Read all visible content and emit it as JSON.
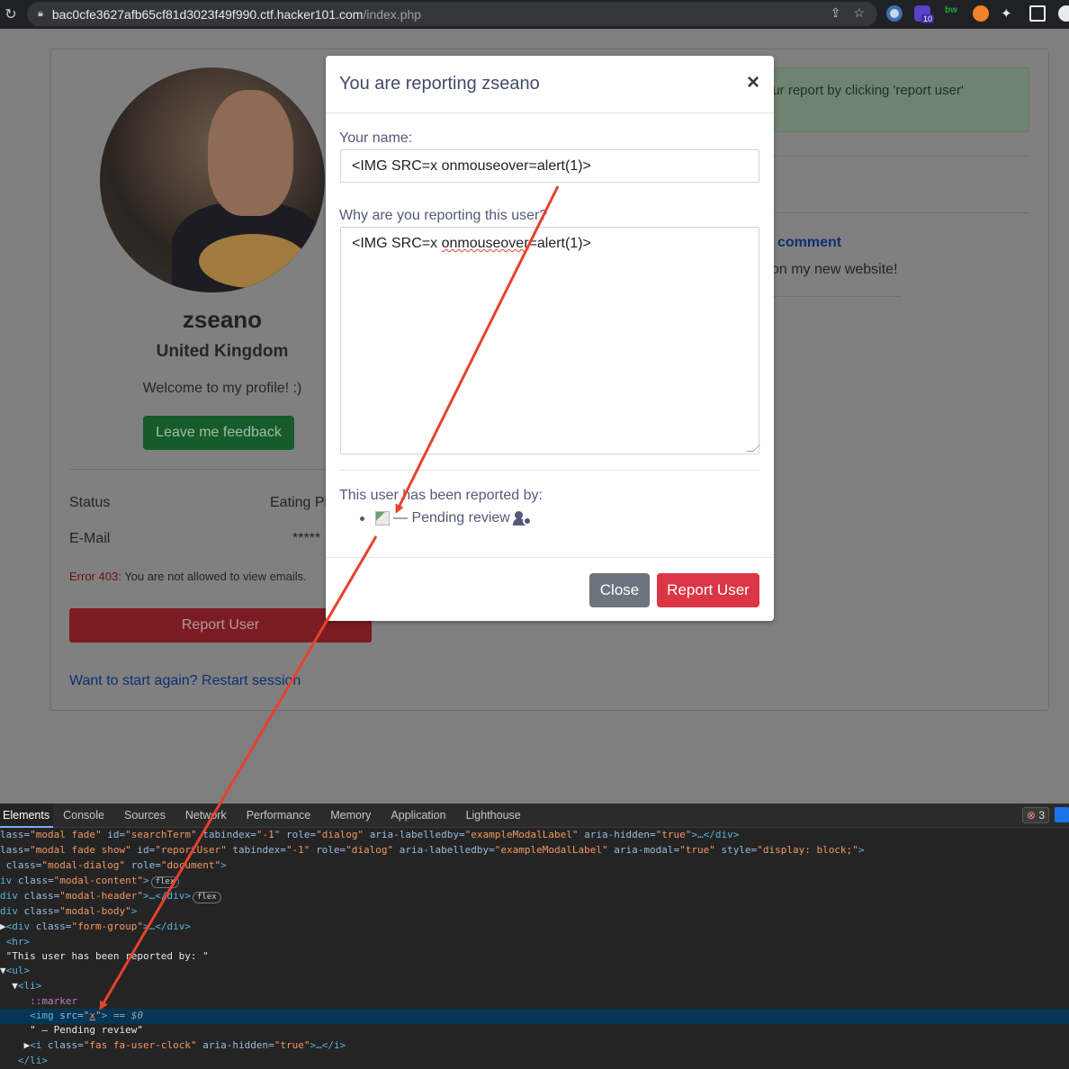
{
  "browser": {
    "url_host": "bac0cfe3627afb65cf81d3023f49f990.ctf.hacker101.com",
    "url_path": "/index.php",
    "extension_badge": "10"
  },
  "profile": {
    "name": "zseano",
    "country": "United Kingdom",
    "welcome": "Welcome to my profile! :)",
    "feedback_button": "Leave me feedback",
    "status_label": "Status",
    "status_value": "Eating Pi",
    "email_label": "E-Mail",
    "email_value": "*****",
    "error_code": "Error 403:",
    "error_text": " You are not allowed to view emails.",
    "report_button": "Report User",
    "restart_link": "Want to start again? Restart session"
  },
  "right_panel": {
    "alert_text": "our report by clicking 'report user'",
    "comment_link": "comment",
    "comment_text": "on my new website!"
  },
  "modal": {
    "title": "You are reporting zseano",
    "close_glyph": "×",
    "name_label": "Your name:",
    "name_value": "<IMG SRC=x onmouseover=alert(1)>",
    "reason_label": "Why are you reporting this user?",
    "reason_pre": "<IMG SRC=x ",
    "reason_squiggle": "onmouseover",
    "reason_post": "=alert(1)>",
    "reported_by_label": "This user has been reported by:",
    "reported_item_text": " — Pending review",
    "close_button": "Close",
    "report_button": "Report User"
  },
  "devtools": {
    "tabs": [
      "Elements",
      "Console",
      "Sources",
      "Network",
      "Performance",
      "Memory",
      "Application",
      "Lighthouse"
    ],
    "error_count": "3",
    "text_node_1": "\"This user has been reported by: \"",
    "marker": "::marker",
    "img_src": "x",
    "selected_suffix": "== $0",
    "text_node_2": "\" — Pending review\"",
    "icon_class": "fas fa-user-clock",
    "flex_badge": "flex"
  },
  "colors": {
    "arrow": "#e8412c",
    "danger": "#dc3545",
    "secondary": "#6c757d"
  }
}
